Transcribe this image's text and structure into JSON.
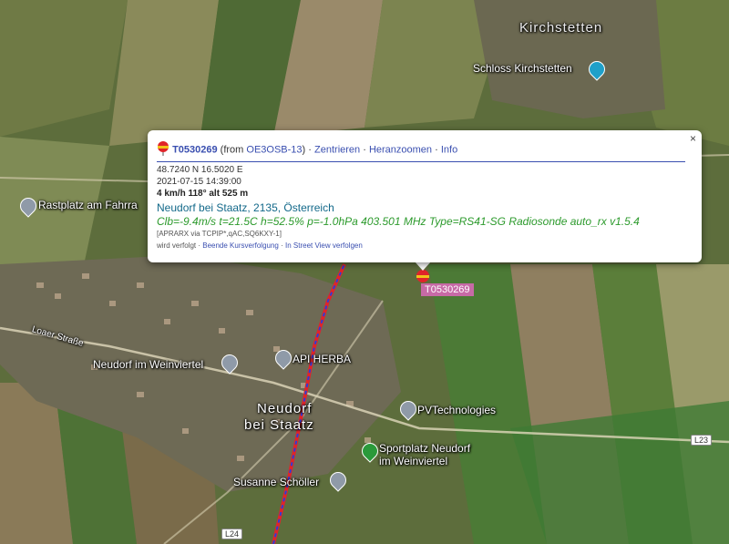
{
  "colors": {
    "track_red": "#e0242a",
    "track_blue": "#2b3fd6",
    "link_blue": "#3a4fb0",
    "telemetry_green": "#2c9a2c",
    "callsign_tag_bg": "#c76aa6"
  },
  "map": {
    "places": {
      "kirchstetten": "Kirchstetten",
      "schloss": "Schloss Kirchstetten",
      "rastplatz": "Rastplatz am Fahrra",
      "loaer_strasse": "Loaer Straße",
      "neudorf_weinviertel": "Neudorf im Weinviertel",
      "api_herba": "API HERBA",
      "neudorf_big_1": "Neudorf",
      "neudorf_big_2": "bei Staatz",
      "pvtechnologies": "PVTechnologies",
      "sportplatz_1": "Sportplatz Neudorf",
      "sportplatz_2": "im Weinviertel",
      "susanne": "Susanne Schöller"
    },
    "road_shields": {
      "l23": "L23",
      "l24": "L24"
    },
    "marker_label": "T0530269"
  },
  "popup": {
    "callsign": "T0530269",
    "from_text": "(from ",
    "from_station": "OE3OSB-13",
    "from_close": ")",
    "links": {
      "center": "Zentrieren",
      "zoom": "Heranzoomen",
      "info": "Info"
    },
    "coords": "48.7240 N 16.5020 E",
    "timestamp": "2021-07-15 14:39:00",
    "speed_line": "4 km/h 118° alt 525 m",
    "location": "Neudorf bei Staatz, 2135, Österreich",
    "telemetry": "Clb=-9.4m/s t=21.5C h=52.5% p=-1.0hPa 403.501 MHz Type=RS41-SG Radiosonde auto_rx v1.5.4",
    "path": "[APRARX via TCPIP*,qAC,SQ6KXY-1]",
    "followed": "wird verfolgt",
    "stop_follow": "Beende Kursverfolgung",
    "street_view": "In Street View verfolgen",
    "close_glyph": "×"
  }
}
